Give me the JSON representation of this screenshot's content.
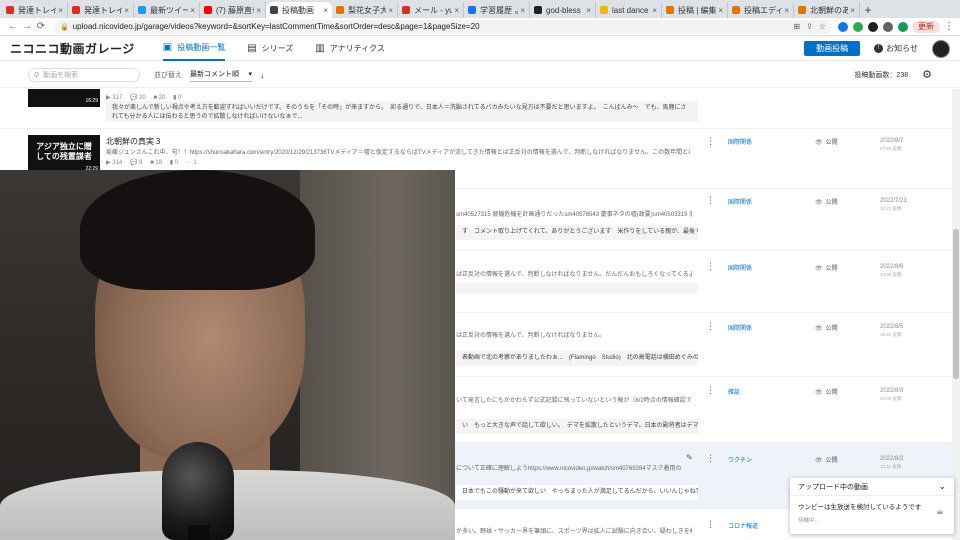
{
  "browser": {
    "tabs": [
      {
        "title": "発達トレイン",
        "color": "#d93025"
      },
      {
        "title": "発達トレイン",
        "color": "#d93025"
      },
      {
        "title": "最新ツイート",
        "color": "#1d9bf0"
      },
      {
        "title": "(7) 藤原直也",
        "color": "#ff0000"
      },
      {
        "title": "投稿動画",
        "color": "#444444",
        "active": true
      },
      {
        "title": "梨花女子大",
        "color": "#e37400"
      },
      {
        "title": "メール - yuji",
        "color": "#d93025"
      },
      {
        "title": "学習履歴 よ",
        "color": "#1a73e8"
      },
      {
        "title": "god-bless",
        "color": "#222222"
      },
      {
        "title": "last dance",
        "color": "#f4b400"
      },
      {
        "title": "投稿 | 編集",
        "color": "#e37400"
      },
      {
        "title": "投稿エディタ",
        "color": "#e37400"
      },
      {
        "title": "北朝鮮のあ",
        "color": "#e37400"
      }
    ],
    "new_tab": "+",
    "url": "upload.nicovideo.jp/garage/videos?keyword=&sortKey=lastCommentTime&sortOrder=desc&page=1&pageSize=20",
    "update_label": "更新"
  },
  "header": {
    "logo": "ニコニコ動画ガレージ",
    "nav": [
      {
        "label": "投稿動画一覧",
        "icon": "▣",
        "active": true
      },
      {
        "label": "シリーズ",
        "icon": "▤"
      },
      {
        "label": "アナリティクス",
        "icon": "▥"
      }
    ],
    "upload_button": "動画投稿",
    "notice_label": "お知らせ"
  },
  "filter": {
    "search_placeholder": "動画を検索",
    "sort_label": "並び替え",
    "sort_value": "最新コメント順",
    "sort_direction": "↓",
    "count_label": "投稿動画数：238"
  },
  "videos": [
    {
      "thumb_duration": "16:29",
      "stats": "▶ 317 　💬 20 　■ 20 　▮ 0",
      "comment": "我々が楽しんで新しい視点や考え方を歓迎すればいいだけです。そのうちを「その時」が来ますから。　卯る通りで、日本人＝洗脳されてるバカみたいな見方は不要だと思いますよ。　こんばんみ〜　でも、馬鹿にされても分かる人には伝わると思うので拡散しなければいけないなぁで..."
    },
    {
      "thumb_text": "アジア独立に贈しての残置謀者",
      "thumb_duration": "22:29",
      "title": "北朝鮮の真実３",
      "desc": "坂藤ジュンさんこれ中、句！！https://shunsakahara.com/entry/2020/12/29/213736TVメディア＝嘘と仮定するならばTVメディアが流してきた情報とは正反対の情報を選んで、判断しなければなりません。この数年間とは比較にならない時代の...",
      "stats": "▶ 314 　💬 9 　■ 18 　▮ 0 　⋯ 1",
      "tag": "国際関係",
      "visibility": "公開",
      "date": "2022/8/7",
      "time": "07:40 投稿"
    },
    {
      "desc": "sm40527315 疲機危機を計画通りだったsm40576543 慶事ネタの嘘(政要)sm40503315 旧道師ら...",
      "comment": "す　コメント取り上げてくれて、ありがとうございます　米作りをしている親が、最後でも15,000",
      "tag": "国際関係",
      "visibility": "公開",
      "date": "2022/7/23",
      "time": "16:21 投稿"
    },
    {
      "desc": "は正反対の情報を選んで、判断しなければなりません。だんだんおもしろくなってくるよ",
      "tag": "国際関係",
      "visibility": "公開",
      "date": "2022/8/6",
      "time": "13:58 投稿"
    },
    {
      "desc": "は正反対の情報を選んで、判断しなければなりません。",
      "comment": "表動画で北の考察がありましたわぁ...　(Flamingo　Studio)　北の高電話は横田めぐみの子供らしい",
      "tag": "国際関係",
      "visibility": "公開",
      "date": "2022/8/5",
      "time": "18:31 投稿"
    },
    {
      "desc": "いて発言したにもかかわらず公式記録に残っていないという報が（6/2時点の情報確認では）進えるの...",
      "comment": "い　もっと大きな声で話して欲しい。　デマを拡散したというデマ。日本の副将者はデマ太",
      "tag": "雑談",
      "visibility": "公開",
      "date": "2022/8/3",
      "time": "01:00 投稿"
    },
    {
      "desc": "について正確に理解しようhttps://www.nicovideo.jp/watch/sm40769284マスク着用の効果...",
      "comment": "日本でもこの騒動が来て欲しい　やっちまった人が満足してるんだから、いいんじゃね？　日",
      "tag": "ワクチン",
      "visibility": "公開",
      "date": "2022/8/2",
      "time": "12:11 投稿"
    },
    {
      "desc": "が多い。野球・サッカー界を筆頭に、スポーツ界は拡人に試験に向き合い、疑わしきを検出すよ...",
      "tag": "コロナ報道"
    }
  ],
  "upload_panel": {
    "title": "アップロード中の動画",
    "item_name": "ウンピーは生放送を検討しているようです",
    "item_status": "待機中..."
  }
}
